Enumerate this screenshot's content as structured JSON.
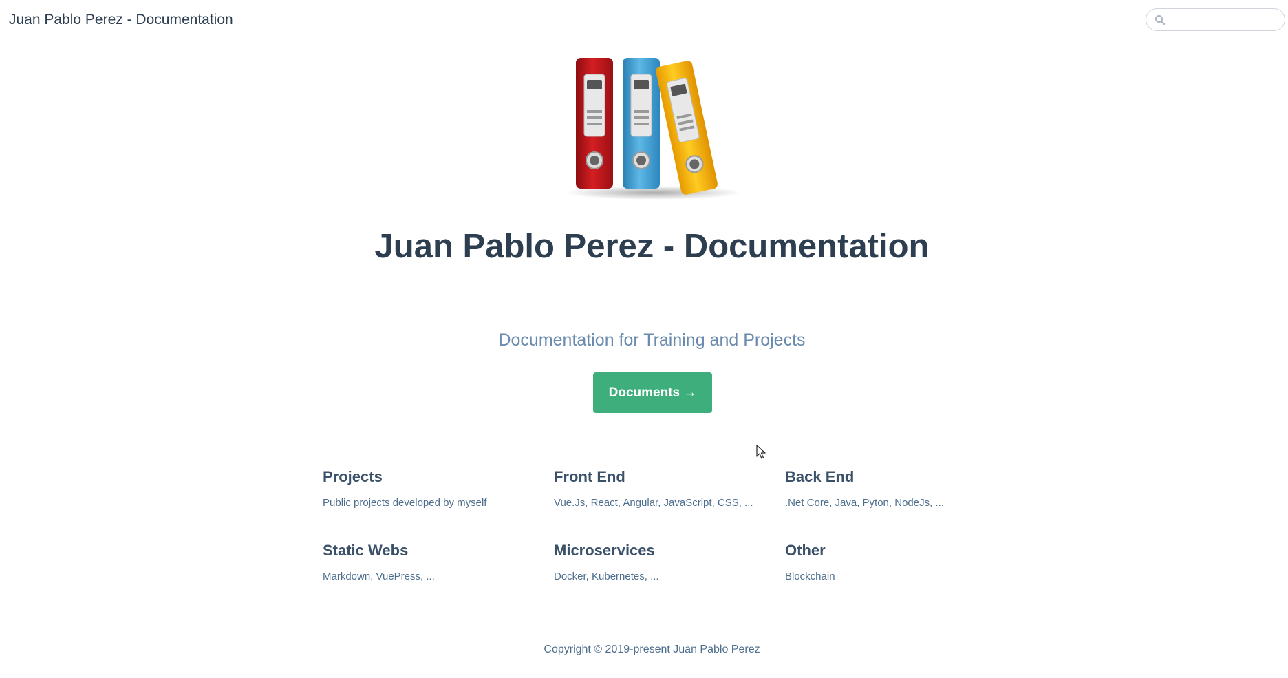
{
  "navbar": {
    "site_name": "Juan Pablo Perez - Documentation",
    "search": {
      "value": "",
      "placeholder": "",
      "icon": "search-icon"
    }
  },
  "hero": {
    "image": "binders-illustration",
    "title": "Juan Pablo Perez - Documentation",
    "description": "Documentation for Training and Projects",
    "action_label": "Documents →",
    "action_color": "#3eaf7c"
  },
  "features": [
    {
      "title": "Projects",
      "details": "Public projects developed by myself"
    },
    {
      "title": "Front End",
      "details": "Vue.Js, React, Angular, JavaScript, CSS, ..."
    },
    {
      "title": "Back End",
      "details": ".Net Core, Java, Pyton, NodeJs, ..."
    },
    {
      "title": "Static Webs",
      "details": "Markdown, VuePress, ..."
    },
    {
      "title": "Microservices",
      "details": "Docker, Kubernetes, ..."
    },
    {
      "title": "Other",
      "details": "Blockchain"
    }
  ],
  "footer": {
    "text": "Copyright © 2019-present Juan Pablo Perez"
  },
  "colors": {
    "accent": "#3eaf7c",
    "text": "#2c3e50",
    "description": "#6a8bad",
    "binder_red": "#c0161a",
    "binder_blue": "#3d9fd6",
    "binder_yellow": "#f5b400"
  }
}
